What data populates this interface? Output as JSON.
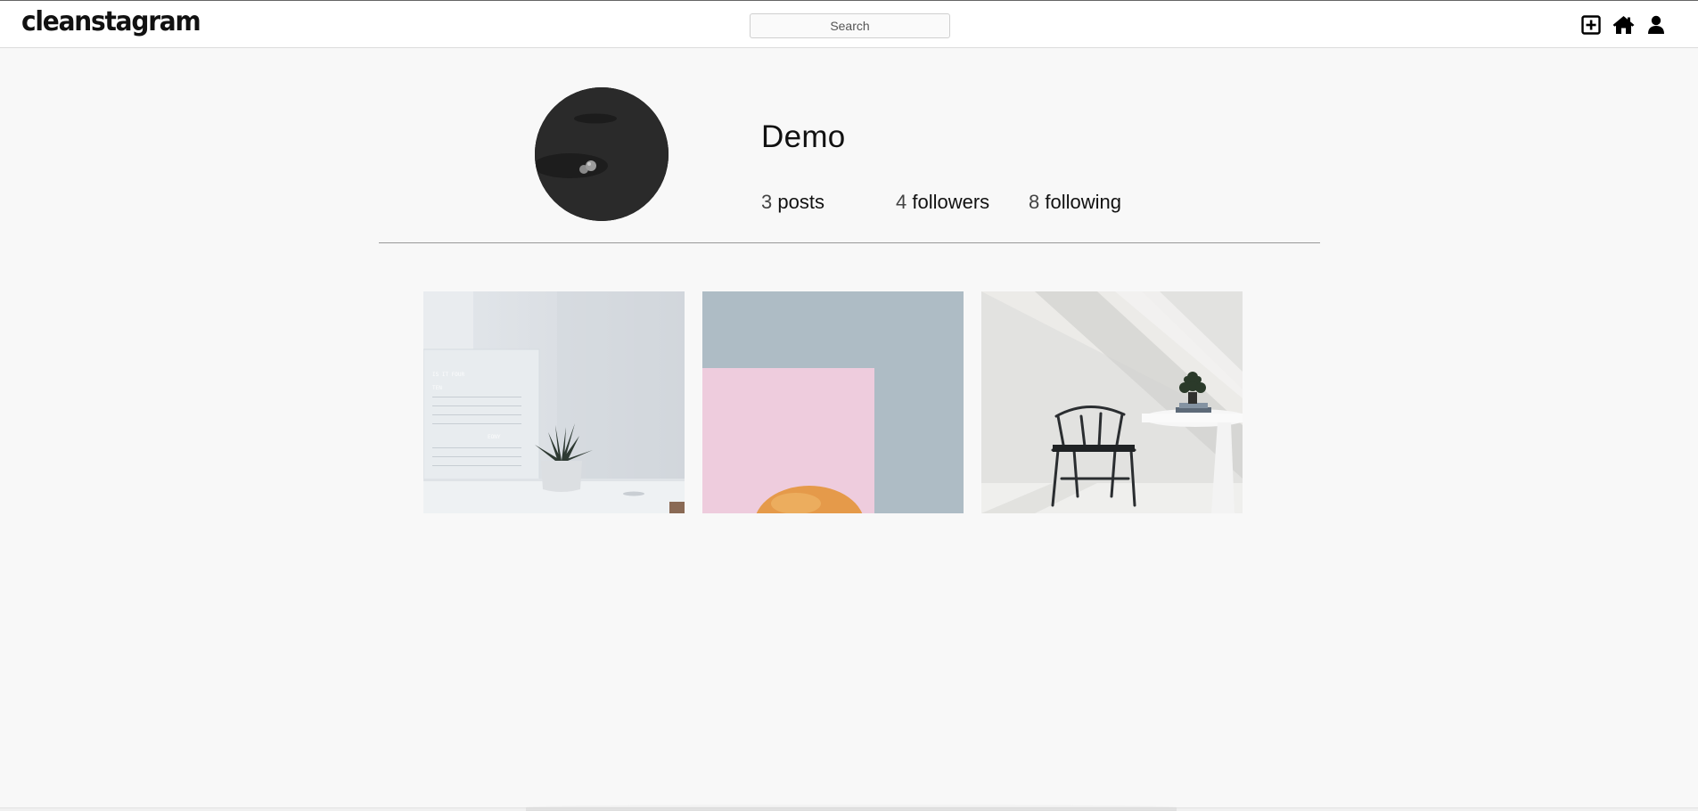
{
  "header": {
    "logo": "cleanstagram",
    "search_placeholder": "Search",
    "icons": [
      "new-post-icon",
      "home-icon",
      "profile-icon"
    ]
  },
  "profile": {
    "username": "Demo",
    "stats": {
      "posts_count": "3",
      "posts_label": "posts",
      "followers_count": "4",
      "followers_label": "followers",
      "following_count": "8",
      "following_label": "following"
    }
  },
  "posts": [
    {
      "subject": "white-desk-plant-word-clock"
    },
    {
      "subject": "peach-on-pink-and-blue"
    },
    {
      "subject": "black-chair-white-table-plant"
    }
  ],
  "colors": {
    "background": "#f8f8f8",
    "topbar": "#ffffff",
    "text": "#111111",
    "divider": "#999999"
  }
}
